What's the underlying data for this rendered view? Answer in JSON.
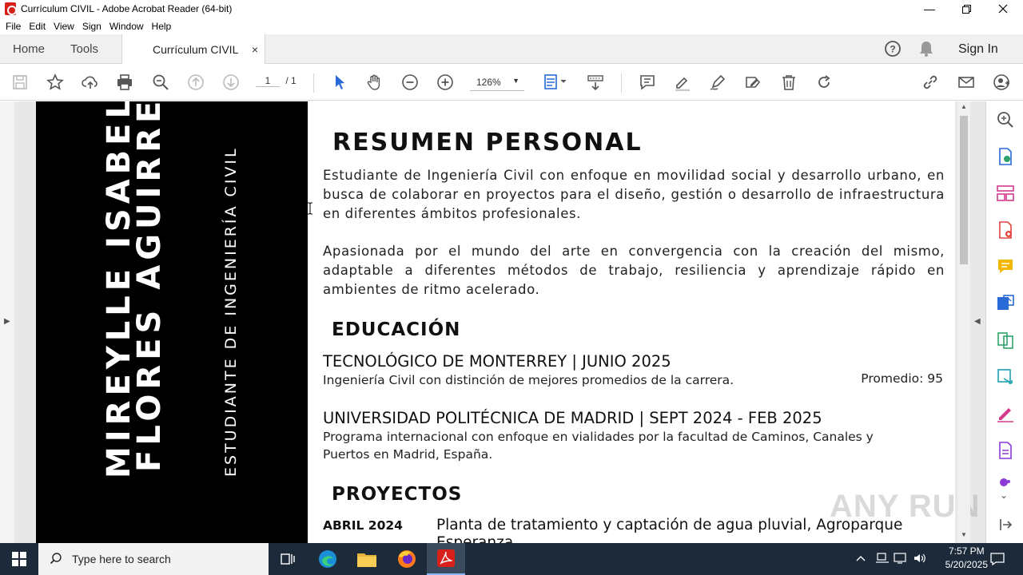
{
  "window": {
    "title": "Currículum CIVIL - Adobe Acrobat Reader (64-bit)"
  },
  "menu": [
    "File",
    "Edit",
    "View",
    "Sign",
    "Window",
    "Help"
  ],
  "tabs": {
    "home": "Home",
    "tools": "Tools",
    "doc": "Currículum CIVIL",
    "close": "×",
    "sign_in": "Sign In"
  },
  "toolbar": {
    "page_current": "1",
    "page_total": "/ 1",
    "zoom": "126%"
  },
  "resume": {
    "name_line1": "MIREYLLE ISABEL",
    "name_line2": "FLORES AGUIRRE",
    "subtitle": "ESTUDIANTE DE INGENIERÍA CIVIL",
    "summary_heading": "RESUMEN PERSONAL",
    "summary_p1": "Estudiante de Ingeniería Civil con enfoque en movilidad social y desarrollo urbano, en busca de colaborar en proyectos para el diseño, gestión o desarrollo de infraestructura en diferentes ámbitos profesionales.",
    "summary_p2": "Apasionada por el mundo del arte en convergencia con la creación del mismo, adaptable a diferentes métodos de trabajo, resiliencia y aprendizaje rápido en ambientes de ritmo acelerado.",
    "education_heading": "EDUCACIÓN",
    "edu1_title": "TECNOLÓGICO DE MONTERREY | JUNIO 2025",
    "edu1_desc": "Ingeniería Civil con distinción de mejores promedios de la carrera.",
    "edu1_avg": "Promedio: 95",
    "edu2_title": "UNIVERSIDAD POLITÉCNICA DE MADRID | SEPT 2024 - FEB 2025",
    "edu2_desc": "Programa internacional con enfoque en vialidades por la facultad de Caminos, Canales y Puertos en Madrid, España.",
    "projects_heading": "PROYECTOS",
    "proj1_date": "ABRIL 2024",
    "proj1_title": "Planta de tratamiento y captación de agua pluvial, Agroparque Esperanza"
  },
  "taskbar": {
    "search_placeholder": "Type here to search",
    "time": "7:57 PM",
    "date": "5/20/2025"
  },
  "watermark": "ANY RUN"
}
